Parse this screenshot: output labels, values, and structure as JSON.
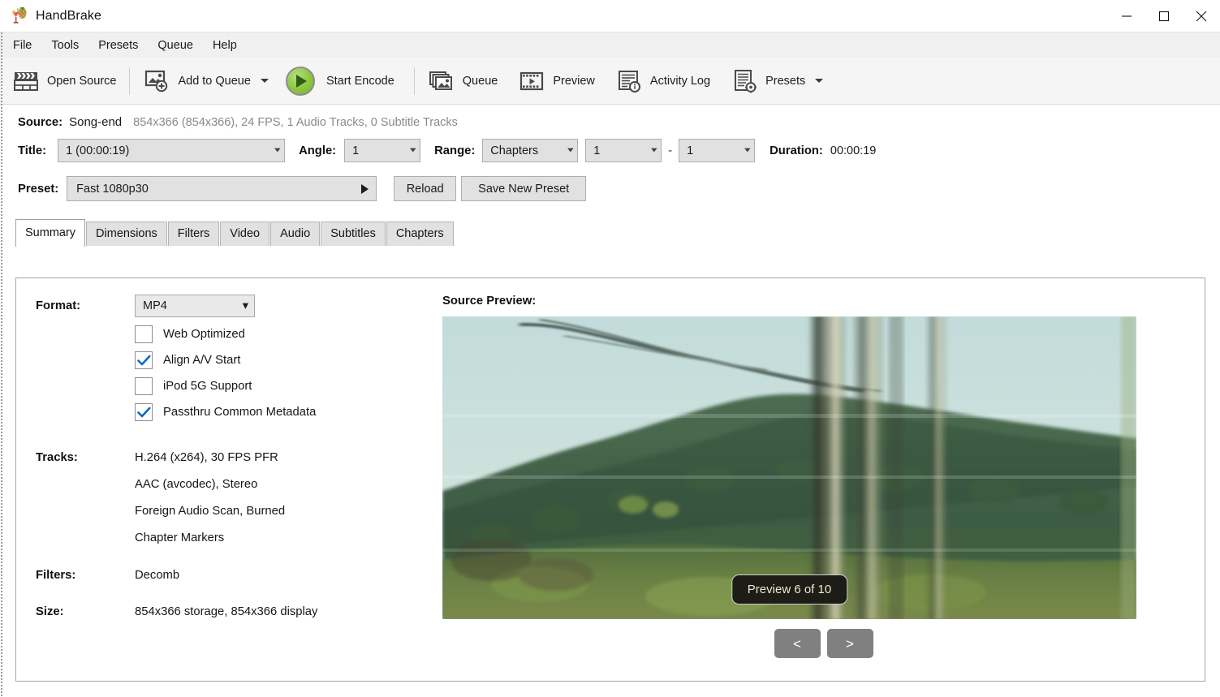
{
  "window": {
    "title": "HandBrake",
    "logo_icon": "handbrake-cocktail-icon",
    "minimize_icon": "minimize-icon",
    "maximize_icon": "maximize-icon",
    "close_icon": "close-icon"
  },
  "menubar": {
    "items": [
      {
        "label": "File"
      },
      {
        "label": "Tools"
      },
      {
        "label": "Presets"
      },
      {
        "label": "Queue"
      },
      {
        "label": "Help"
      }
    ]
  },
  "toolbar": {
    "open_source": {
      "label": "Open Source",
      "icon": "clapperboard-icon"
    },
    "add_to_queue": {
      "label": "Add to Queue",
      "icon": "add-image-icon",
      "has_dropdown": true
    },
    "start_encode": {
      "label": "Start Encode",
      "icon": "green-play-icon"
    },
    "queue": {
      "label": "Queue",
      "icon": "stacked-images-icon"
    },
    "preview": {
      "label": "Preview",
      "icon": "film-strip-play-icon"
    },
    "activity_log": {
      "label": "Activity Log",
      "icon": "document-info-icon"
    },
    "presets": {
      "label": "Presets",
      "icon": "document-gear-icon",
      "has_dropdown": true
    }
  },
  "source": {
    "label": "Source:",
    "name": "Song-end",
    "meta": "854x366 (854x366), 24 FPS, 1 Audio Tracks, 0 Subtitle Tracks"
  },
  "title_row": {
    "title_label": "Title:",
    "title_value": "1  (00:00:19)",
    "angle_label": "Angle:",
    "angle_value": "1",
    "range_label": "Range:",
    "range_value": "Chapters",
    "range_start": "1",
    "range_dash": "-",
    "range_end": "1",
    "duration_label": "Duration:",
    "duration_value": "00:00:19"
  },
  "preset_row": {
    "preset_label": "Preset:",
    "preset_value": "Fast 1080p30",
    "reload_label": "Reload",
    "save_label": "Save New Preset"
  },
  "tabs": [
    {
      "label": "Summary",
      "active": true
    },
    {
      "label": "Dimensions",
      "active": false
    },
    {
      "label": "Filters",
      "active": false
    },
    {
      "label": "Video",
      "active": false
    },
    {
      "label": "Audio",
      "active": false
    },
    {
      "label": "Subtitles",
      "active": false
    },
    {
      "label": "Chapters",
      "active": false
    }
  ],
  "summary": {
    "format_label": "Format:",
    "format_value": "MP4",
    "checkboxes": [
      {
        "label": "Web Optimized",
        "checked": false
      },
      {
        "label": "Align A/V Start",
        "checked": true
      },
      {
        "label": "iPod 5G Support",
        "checked": false
      },
      {
        "label": "Passthru Common Metadata",
        "checked": true
      }
    ],
    "tracks_label": "Tracks:",
    "tracks": [
      "H.264 (x264), 30 FPS PFR",
      "AAC (avcodec), Stereo",
      "Foreign Audio Scan, Burned",
      "Chapter Markers"
    ],
    "filters_label": "Filters:",
    "filters_value": "Decomb",
    "size_label": "Size:",
    "size_value": "854x366 storage, 854x366 display"
  },
  "preview": {
    "heading": "Source Preview:",
    "badge": "Preview 6 of 10",
    "prev_label": "<",
    "next_label": ">"
  },
  "colors": {
    "accent_checkbox": "#0f6cbd",
    "toolbar_bg": "#f5f5f5",
    "menu_bg": "#f0f0f0",
    "control_bg": "#e1e1e1",
    "badge_bg": "#1d1c17",
    "nav_btn_bg": "#808080"
  }
}
